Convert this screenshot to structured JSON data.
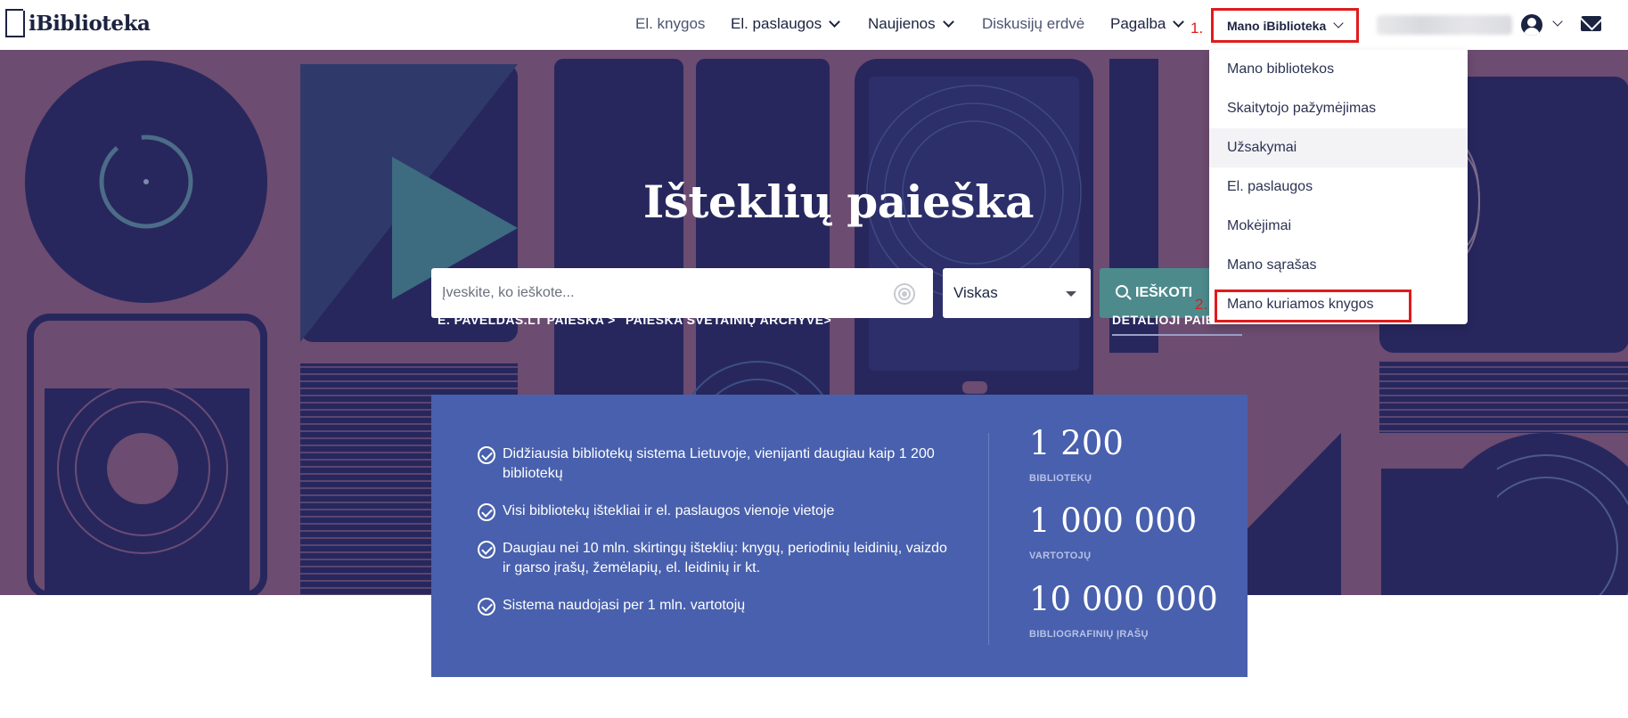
{
  "header": {
    "logo_text": "iBiblioteka",
    "nav": [
      {
        "label": "El. knygos"
      },
      {
        "label": "El. paslaugos"
      },
      {
        "label": "Naujienos"
      },
      {
        "label": "Diskusijų erdvė"
      },
      {
        "label": "Pagalba"
      }
    ],
    "mano_label": "Mano iBiblioteka",
    "annotation_1": "1.",
    "annotation_2": "2."
  },
  "hero": {
    "title": "Išteklių paieška",
    "search_placeholder": "Įveskite, ko ieškote...",
    "select_value": "Viskas",
    "search_button": "IEŠKOTI",
    "links": [
      "E. PAVELDAS.LT PAIEŠKA >",
      "PAIEŠKA SVETAINIŲ ARCHYVE>",
      "DETALIOJI PAIEŠKA"
    ]
  },
  "dropdown": {
    "items": [
      "Mano bibliotekos",
      "Skaitytojo pažymėjimas",
      "Užsakymai",
      "El. paslaugos",
      "Mokėjimai",
      "Mano sąrašas",
      "Mano kuriamos knygos"
    ]
  },
  "info": {
    "features": [
      "Didžiausia bibliotekų sistema Lietuvoje, vienijanti daugiau kaip 1 200 bibliotekų",
      "Visi bibliotekų ištekliai ir el. paslaugos vienoje vietoje",
      "Daugiau nei 10 mln. skirtingų išteklių: knygų, periodinių leidinių, vaizdo ir garso įrašų, žemėlapių, el. leidinių ir kt.",
      "Sistema naudojasi per 1 mln. vartotojų"
    ],
    "stats": [
      {
        "value": "1 200",
        "label": "BIBLIOTEKŲ"
      },
      {
        "value": "1 000 000",
        "label": "VARTOTOJŲ"
      },
      {
        "value": "10 000 000",
        "label": "BIBLIOGRAFINIŲ ĮRAŠŲ"
      }
    ]
  },
  "colors": {
    "hero_bg": "#6c4c70",
    "dark_shape": "#27275e",
    "info_bg": "#4860ad",
    "button_teal": "#4d8a8c",
    "annotation_red": "#e01b1b"
  }
}
